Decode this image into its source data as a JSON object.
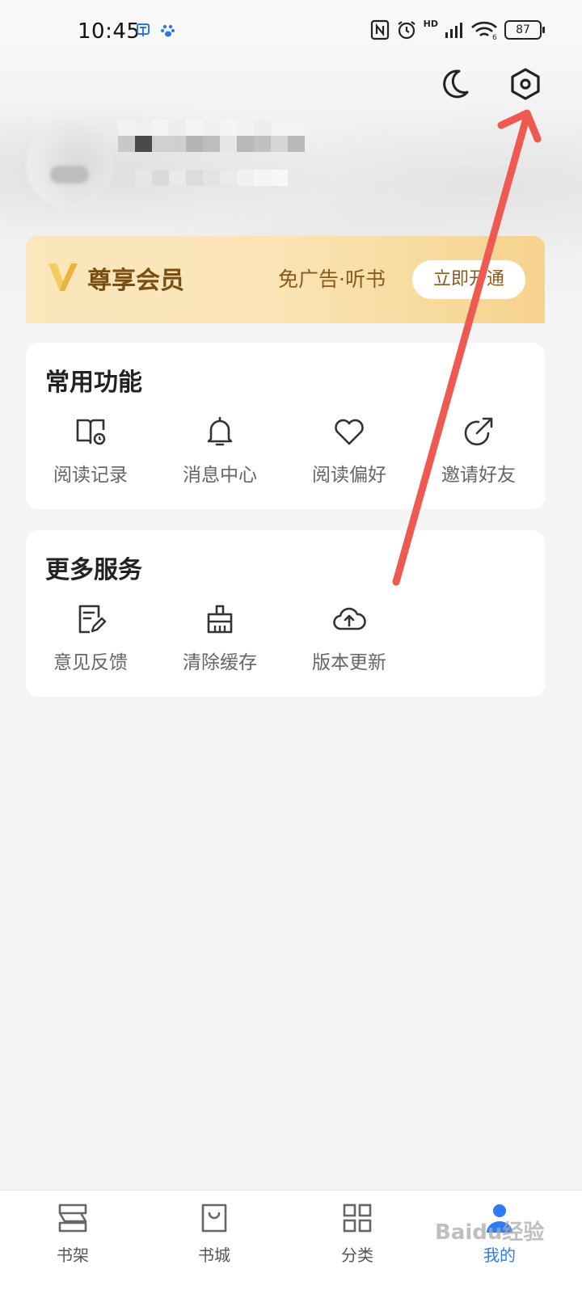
{
  "status_bar": {
    "time": "10:45",
    "battery": "87",
    "network": "HD"
  },
  "header": {
    "night_mode_icon": "moon-icon",
    "settings_icon": "settings-hexagon-icon"
  },
  "vip": {
    "title": "尊享会员",
    "perks": "免广告·听书",
    "button": "立即开通"
  },
  "common": {
    "title": "常用功能",
    "items": [
      {
        "label": "阅读记录",
        "icon": "book-clock-icon"
      },
      {
        "label": "消息中心",
        "icon": "bell-icon"
      },
      {
        "label": "阅读偏好",
        "icon": "heart-icon"
      },
      {
        "label": "邀请好友",
        "icon": "share-arrow-icon"
      }
    ]
  },
  "more": {
    "title": "更多服务",
    "items": [
      {
        "label": "意见反馈",
        "icon": "feedback-doc-icon"
      },
      {
        "label": "清除缓存",
        "icon": "broom-icon"
      },
      {
        "label": "版本更新",
        "icon": "cloud-upload-icon"
      }
    ]
  },
  "bottom_nav": {
    "items": [
      {
        "label": "书架",
        "icon": "bookshelf-icon"
      },
      {
        "label": "书城",
        "icon": "shopping-bag-icon"
      },
      {
        "label": "分类",
        "icon": "grid-icon"
      },
      {
        "label": "我的",
        "icon": "user-icon"
      }
    ],
    "active_index": 3
  },
  "watermark": "Baidu经验",
  "colors": {
    "accent": "#2f7bf3",
    "vip_text": "#8a5a1a",
    "annotation": "#ee5a52"
  }
}
